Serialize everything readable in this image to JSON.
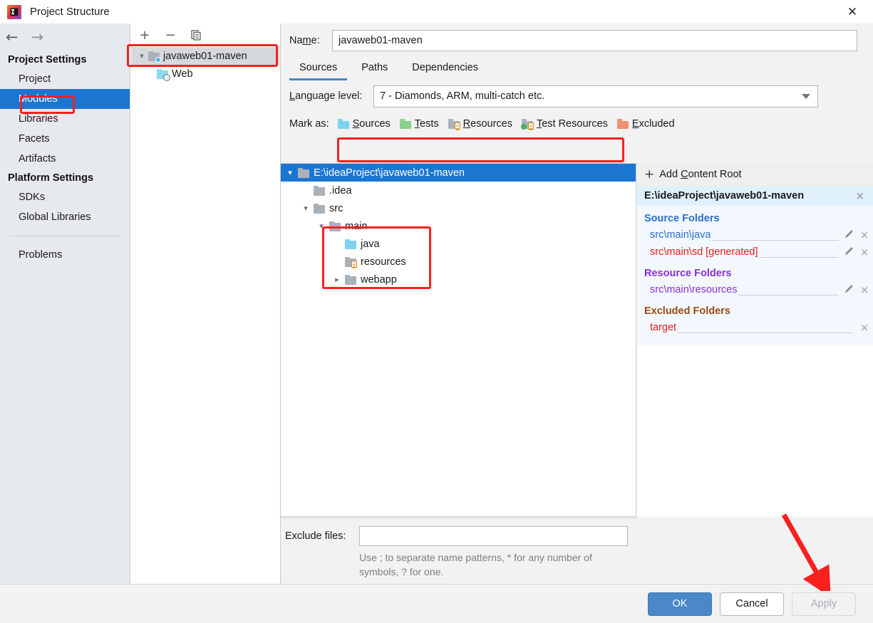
{
  "window": {
    "title": "Project Structure",
    "logo_icon": "intellij-idea-logo",
    "close_icon": "✕"
  },
  "sidebar": {
    "back_icon": "←",
    "forward_icon": "→",
    "groups": [
      {
        "label": "Project Settings",
        "items": [
          {
            "label": "Project",
            "selected": false
          },
          {
            "label": "Modules",
            "selected": true
          },
          {
            "label": "Libraries",
            "selected": false
          },
          {
            "label": "Facets",
            "selected": false
          },
          {
            "label": "Artifacts",
            "selected": false
          }
        ]
      },
      {
        "label": "Platform Settings",
        "items": [
          {
            "label": "SDKs",
            "selected": false
          },
          {
            "label": "Global Libraries",
            "selected": false
          }
        ]
      }
    ],
    "problems_label": "Problems"
  },
  "module_panel": {
    "toolbar": {
      "add_icon": "+",
      "remove_icon": "−",
      "copy_icon": "copy-icon"
    },
    "tree": [
      {
        "label": "javaweb01-maven",
        "icon": "module-folder-icon",
        "expanded": true,
        "selected": true
      },
      {
        "label": "Web",
        "icon": "web-facet-icon",
        "expanded": false,
        "selected": false
      }
    ]
  },
  "main": {
    "name_label": "Name:",
    "name_value": "javaweb01-maven",
    "tabs": [
      {
        "label": "Sources",
        "active": true
      },
      {
        "label": "Paths",
        "active": false
      },
      {
        "label": "Dependencies",
        "active": false
      }
    ],
    "language_level_label": "Language level:",
    "language_level_value": "7 - Diamonds, ARM, multi-catch etc.",
    "mark_as_label": "Mark as:",
    "mark_as_buttons": [
      {
        "label": "Sources",
        "mnemonic": "S",
        "rest": "ources",
        "icon": "sources-folder-icon"
      },
      {
        "label": "Tests",
        "mnemonic": "T",
        "rest": "ests",
        "icon": "tests-folder-icon"
      },
      {
        "label": "Resources",
        "mnemonic": "R",
        "rest": "esources",
        "icon": "resources-folder-icon"
      },
      {
        "label": "Test Resources",
        "mnemonic": "T",
        "rest": "est Resources",
        "icon": "test-resources-folder-icon"
      },
      {
        "label": "Excluded",
        "mnemonic": "E",
        "rest": "xcluded",
        "icon": "excluded-folder-icon"
      }
    ],
    "content_tree": [
      {
        "label": "E:\\ideaProject\\javaweb01-maven",
        "indent": 0,
        "twisty": "expanded",
        "icon": "gray-folder-icon",
        "selected": true
      },
      {
        "label": ".idea",
        "indent": 1,
        "twisty": "none",
        "icon": "gray-folder-icon",
        "selected": false
      },
      {
        "label": "src",
        "indent": 1,
        "twisty": "expanded",
        "icon": "gray-folder-icon",
        "selected": false
      },
      {
        "label": "main",
        "indent": 2,
        "twisty": "expanded",
        "icon": "gray-folder-icon",
        "selected": false
      },
      {
        "label": "java",
        "indent": 3,
        "twisty": "none",
        "icon": "sources-folder-icon",
        "selected": false
      },
      {
        "label": "resources",
        "indent": 3,
        "twisty": "none",
        "icon": "resources-folder-icon",
        "selected": false
      },
      {
        "label": "webapp",
        "indent": 3,
        "twisty": "collapsed",
        "icon": "gray-folder-icon",
        "selected": false
      }
    ],
    "exclude_files_label": "Exclude files:",
    "exclude_files_value": "",
    "exclude_files_hint": "Use ; to separate name patterns, * for any number of symbols, ? for one."
  },
  "details": {
    "add_content_root_label": "Add Content Root",
    "add_content_root_mnemonic": "C",
    "add_icon": "+",
    "content_root_path": "E:\\ideaProject\\javaweb01-maven",
    "remove_icon": "×",
    "sections": [
      {
        "heading": "Source Folders",
        "heading_color": "#2a6fc9",
        "folders": [
          {
            "path": "src\\main\\java",
            "color": "#2a6fc9",
            "editable": true
          },
          {
            "path": "src\\main\\sd [generated]",
            "color": "#e02020",
            "editable": true
          }
        ]
      },
      {
        "heading": "Resource Folders",
        "heading_color": "#8b2fd8",
        "folders": [
          {
            "path": "src\\main\\resources",
            "color": "#8b2fd8",
            "editable": true
          }
        ]
      },
      {
        "heading": "Excluded Folders",
        "heading_color": "#9c4a12",
        "folders": [
          {
            "path": "target",
            "color": "#e02020",
            "editable": false
          }
        ]
      }
    ],
    "edit_icon": "✎"
  },
  "buttons": {
    "ok": "OK",
    "cancel": "Cancel",
    "apply": "Apply"
  },
  "annotations": {
    "accent_color": "#fa2020",
    "boxes": [
      {
        "name": "module-node-highlight"
      },
      {
        "name": "modules-nav-highlight"
      },
      {
        "name": "mark-as-highlight"
      },
      {
        "name": "source-folders-highlight"
      }
    ],
    "arrow": {
      "name": "apply-button-arrow"
    }
  }
}
